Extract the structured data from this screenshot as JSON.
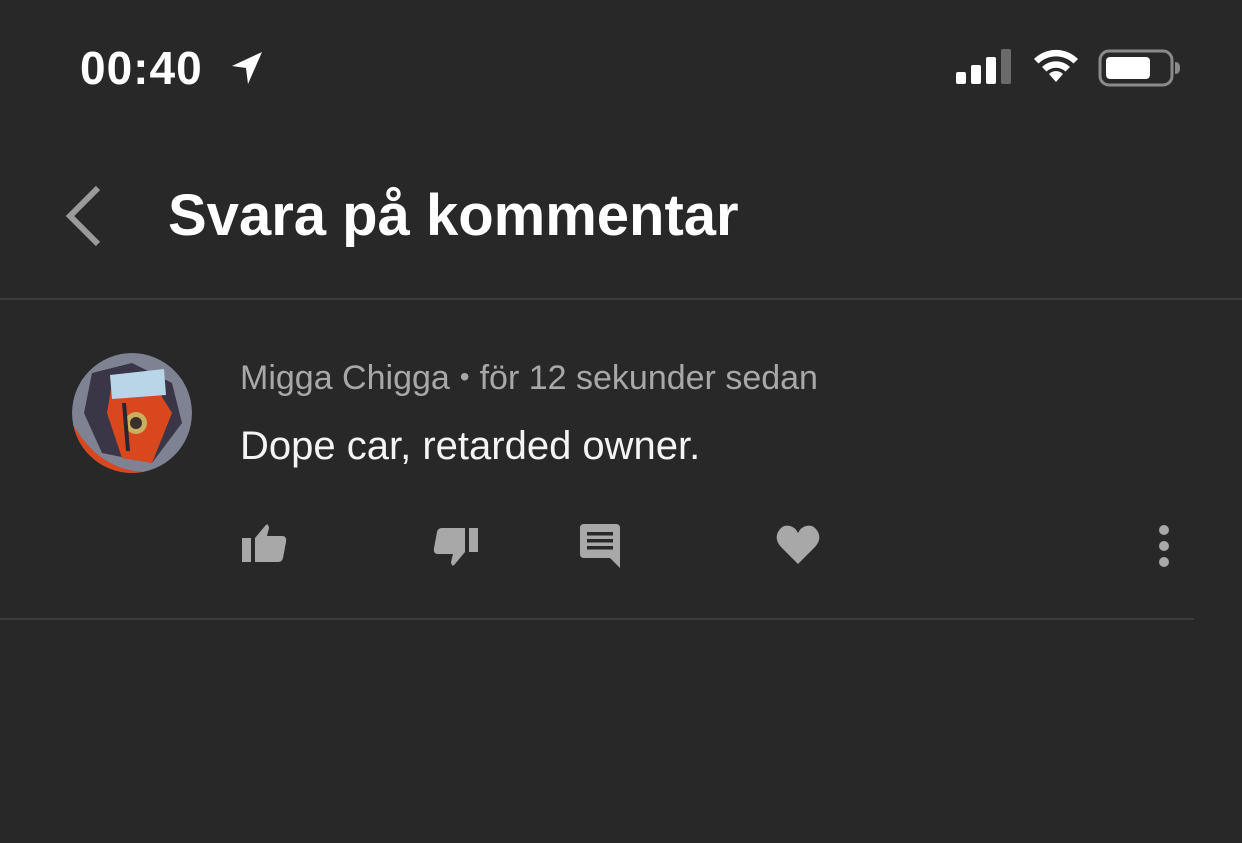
{
  "status_bar": {
    "time": "00:40",
    "icons": [
      "location-arrow-icon",
      "cellular-signal-icon",
      "wifi-icon",
      "battery-icon"
    ]
  },
  "header": {
    "back_icon": "chevron-left-icon",
    "title": "Svara på kommentar"
  },
  "comment": {
    "author": "Migga Chigga",
    "separator": "•",
    "timestamp": "för 12 sekunder sedan",
    "text": "Dope car, retarded owner.",
    "actions": [
      "thumbs-up-icon",
      "thumbs-down-icon",
      "reply-icon",
      "heart-icon",
      "more-vert-icon"
    ]
  },
  "colors": {
    "background": "#282828",
    "divider": "#3c3c3c",
    "primary_text": "#ffffff",
    "secondary_text": "#a8a8a8",
    "icon": "#a8a8a8"
  }
}
